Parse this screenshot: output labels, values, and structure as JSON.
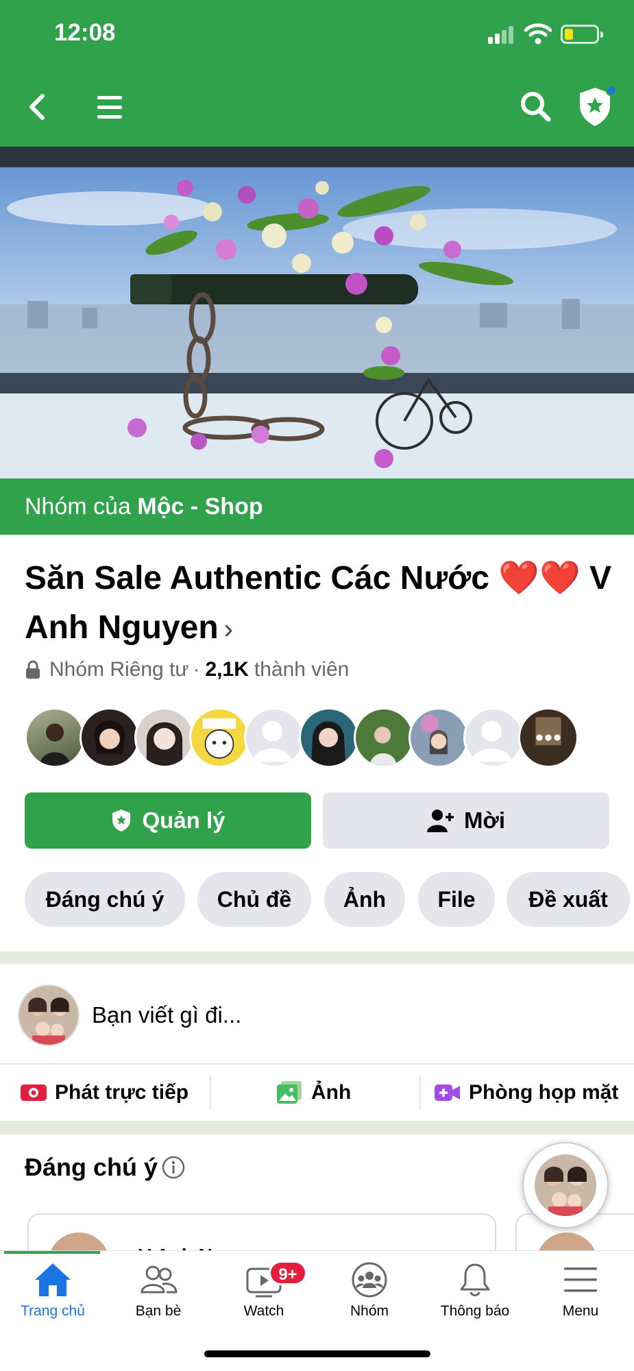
{
  "status_bar": {
    "time": "12:08"
  },
  "cover": {
    "owner_prefix": "Nhóm của ",
    "owner_name": "Mộc - Shop"
  },
  "group": {
    "name": "Săn Sale Authentic Các Nước ❤️❤️ V Anh Nguyen",
    "privacy": "Nhóm Riêng tư",
    "separator": "·",
    "member_count": "2,1K",
    "member_label": "thành viên"
  },
  "buttons": {
    "manage": "Quản lý",
    "invite": "Mời"
  },
  "chips": [
    "Đáng chú ý",
    "Chủ đề",
    "Ảnh",
    "File",
    "Đề xuất"
  ],
  "composer": {
    "placeholder": "Bạn viết gì đi..."
  },
  "actions": {
    "live": "Phát trực tiếp",
    "photo": "Ảnh",
    "room": "Phòng họp mặt"
  },
  "featured": {
    "title": "Đáng chú ý",
    "card_name": "V Anh Nguyen",
    "more": "•••"
  },
  "tabbar": {
    "items": [
      {
        "label": "Trang chủ",
        "icon": "home-icon",
        "active": true
      },
      {
        "label": "Bạn bè",
        "icon": "friends-icon"
      },
      {
        "label": "Watch",
        "icon": "watch-icon",
        "badge": "9+"
      },
      {
        "label": "Nhóm",
        "icon": "groups-icon"
      },
      {
        "label": "Thông báo",
        "icon": "bell-icon"
      },
      {
        "label": "Menu",
        "icon": "menu-lines-icon"
      }
    ]
  },
  "colors": {
    "brand_green": "#31a24c",
    "badge_red": "#e41e3f",
    "active_tab_blue": "#1b74e4"
  }
}
